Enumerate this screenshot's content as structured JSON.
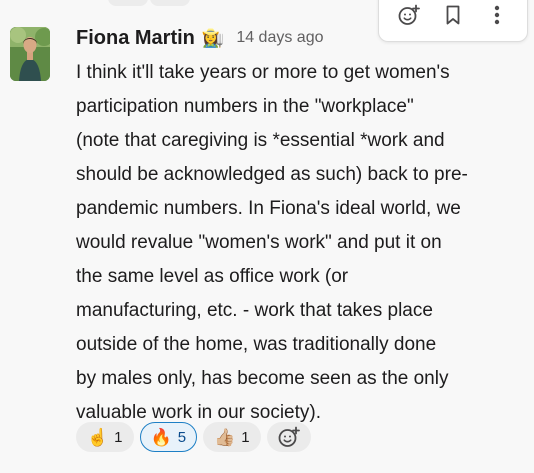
{
  "message": {
    "author": "Fiona Martin",
    "status_emoji": "👩‍🌾",
    "timestamp": "14 days ago",
    "body_lines": [
      "I think it'll take years or more to get women's",
      "participation numbers in the \"workplace\"",
      "(note that caregiving is *essential *work and",
      "should be acknowledged as such) back to pre-",
      "pandemic numbers. In Fiona's ideal world, we",
      "would revalue \"women's work\" and put it on",
      "the same level as office work (or",
      "manufacturing, etc. - work that takes place",
      "outside of the home, was traditionally done",
      "by males only, has become seen as the only",
      "valuable work in our society)."
    ]
  },
  "reactions": [
    {
      "emoji": "☝️",
      "count": "1",
      "active": false,
      "icon": "index-pointing-up-emoji"
    },
    {
      "emoji": "🔥",
      "count": "5",
      "active": true,
      "icon": "fire-emoji"
    },
    {
      "emoji": "👍🏼",
      "count": "1",
      "active": false,
      "icon": "thumbs-up-emoji"
    }
  ],
  "actions": [
    {
      "icon": "add-reaction-icon"
    },
    {
      "icon": "bookmark-icon"
    },
    {
      "icon": "more-options-icon"
    }
  ],
  "colors": {
    "background": "#f8f8f8",
    "text": "#1d1c1d",
    "timestamp": "#616061",
    "reaction_bg": "#ebebeb",
    "reaction_active_bg": "#e8f2fa",
    "reaction_active_border": "#1d7fc5",
    "reaction_active_text": "#0b4c8c"
  }
}
